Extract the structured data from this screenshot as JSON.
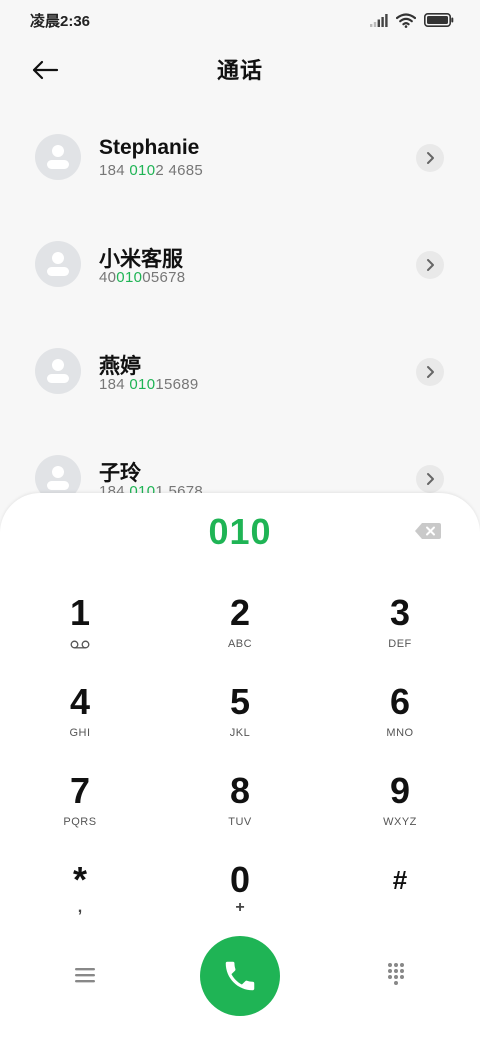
{
  "status_bar": {
    "time": "凌晨2:36"
  },
  "header": {
    "title": "通话"
  },
  "contacts": [
    {
      "name": "Stephanie",
      "number_pre": "184 ",
      "number_hl": "010",
      "number_post": "2 4685"
    },
    {
      "name": "小米客服",
      "number_pre": "40",
      "number_hl": "010",
      "number_post": "05678"
    },
    {
      "name": "燕婷",
      "number_pre": "184 ",
      "number_hl": "010",
      "number_post": "15689"
    },
    {
      "name": "子玲",
      "number_pre": "184 ",
      "number_hl": "010",
      "number_post": "1 5678"
    }
  ],
  "dialpad": {
    "dialed": "010",
    "keys": [
      {
        "digit": "1",
        "letters": ""
      },
      {
        "digit": "2",
        "letters": "ABC"
      },
      {
        "digit": "3",
        "letters": "DEF"
      },
      {
        "digit": "4",
        "letters": "GHI"
      },
      {
        "digit": "5",
        "letters": "JKL"
      },
      {
        "digit": "6",
        "letters": "MNO"
      },
      {
        "digit": "7",
        "letters": "PQRS"
      },
      {
        "digit": "8",
        "letters": "TUV"
      },
      {
        "digit": "9",
        "letters": "WXYZ"
      },
      {
        "digit": "*",
        "letters": ","
      },
      {
        "digit": "0",
        "letters": "+"
      },
      {
        "digit": "#",
        "letters": ""
      }
    ]
  },
  "icons": {
    "back": "arrow-left-icon",
    "detail": "chevron-right-icon",
    "delete": "backspace-icon",
    "menu": "menu-icon",
    "call": "phone-icon",
    "dialpad": "dialpad-icon",
    "voicemail": "voicemail-icon"
  },
  "colors": {
    "accent": "#1fb455",
    "background": "#f7f7f7",
    "avatar": "#e1e3e6"
  }
}
